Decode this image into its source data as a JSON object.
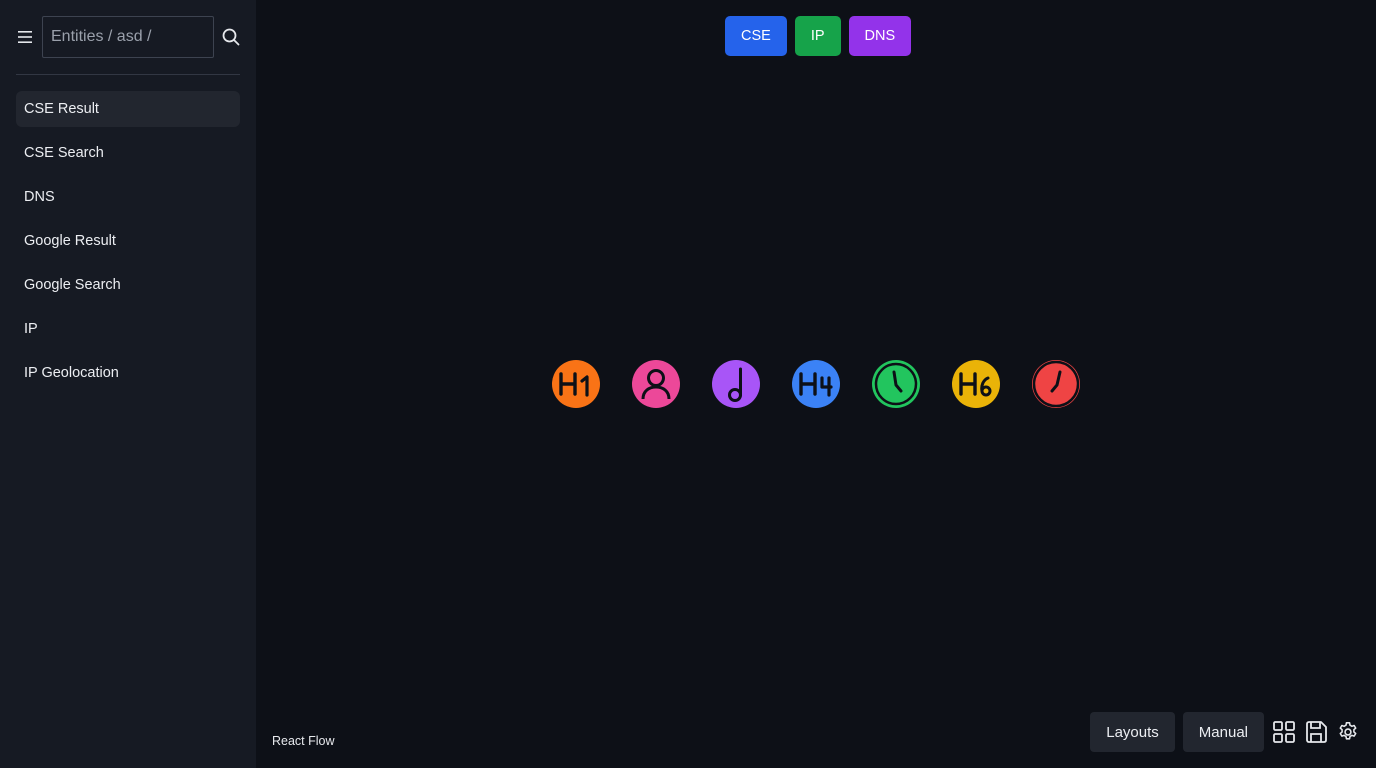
{
  "sidebar": {
    "search": {
      "value": "",
      "placeholder": "Entities / asd /"
    },
    "items": [
      {
        "label": "CSE Result",
        "active": true
      },
      {
        "label": "CSE Search"
      },
      {
        "label": "DNS"
      },
      {
        "label": "Google Result"
      },
      {
        "label": "Google Search"
      },
      {
        "label": "IP"
      },
      {
        "label": "IP Geolocation"
      }
    ],
    "icons": {
      "menu": "hamburger-menu-icon",
      "search": "search-icon"
    }
  },
  "type_buttons": [
    {
      "label": "CSE",
      "color": "#2563eb"
    },
    {
      "label": "IP",
      "color": "#16a34a"
    },
    {
      "label": "DNS",
      "color": "#9333ea"
    }
  ],
  "nodes": [
    {
      "icon": "heading-1-icon",
      "color": "#f97316"
    },
    {
      "icon": "user-icon",
      "color": "#ec4899"
    },
    {
      "icon": "music-note-icon",
      "color": "#a855f7"
    },
    {
      "icon": "heading-4-icon",
      "color": "#3b82f6"
    },
    {
      "icon": "clock-icon",
      "color": "#22c55e"
    },
    {
      "icon": "heading-6-icon",
      "color": "#eab308"
    },
    {
      "icon": "clock-icon",
      "color": "#ef4444"
    }
  ],
  "canvas": {
    "attribution": "React Flow"
  },
  "bottom_bar": {
    "layouts_label": "Layouts",
    "manual_label": "Manual",
    "icons": [
      "grid-icon",
      "save-icon",
      "settings-gear-icon"
    ]
  }
}
